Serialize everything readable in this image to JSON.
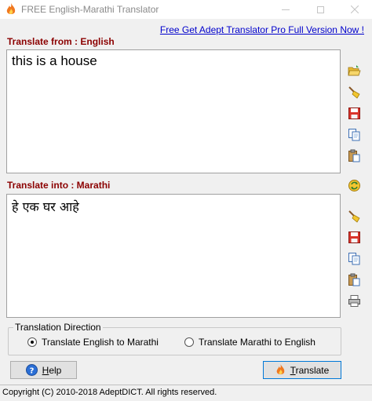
{
  "window": {
    "title": "FREE English-Marathi Translator"
  },
  "promo_link": "Free Get Adept Translator Pro Full Version Now !",
  "source": {
    "label": "Translate from : English",
    "text": "this is a house"
  },
  "target": {
    "label": "Translate into : Marathi",
    "text": "हे एक घर आहे"
  },
  "toolbar_icons": [
    "open-folder-icon",
    "clear-broom-icon",
    "save-icon",
    "copy-icon",
    "paste-icon",
    "swap-icon",
    "clear-broom-icon",
    "save-icon",
    "copy-icon",
    "paste-icon",
    "print-icon"
  ],
  "direction": {
    "legend": "Translation Direction",
    "options": [
      "Translate English to Marathi",
      "Translate Marathi to English"
    ],
    "selected": "Translate English to Marathi"
  },
  "buttons": {
    "help_prefix": "",
    "help_accel": "H",
    "help_rest": "elp",
    "translate_accel": "T",
    "translate_rest": "ranslate"
  },
  "status": "Copyright (C) 2010-2018 AdeptDICT. All rights reserved.",
  "colors": {
    "label_red": "#8b0000",
    "link_blue": "#0000cc",
    "window_bg": "#f0f0f0"
  }
}
